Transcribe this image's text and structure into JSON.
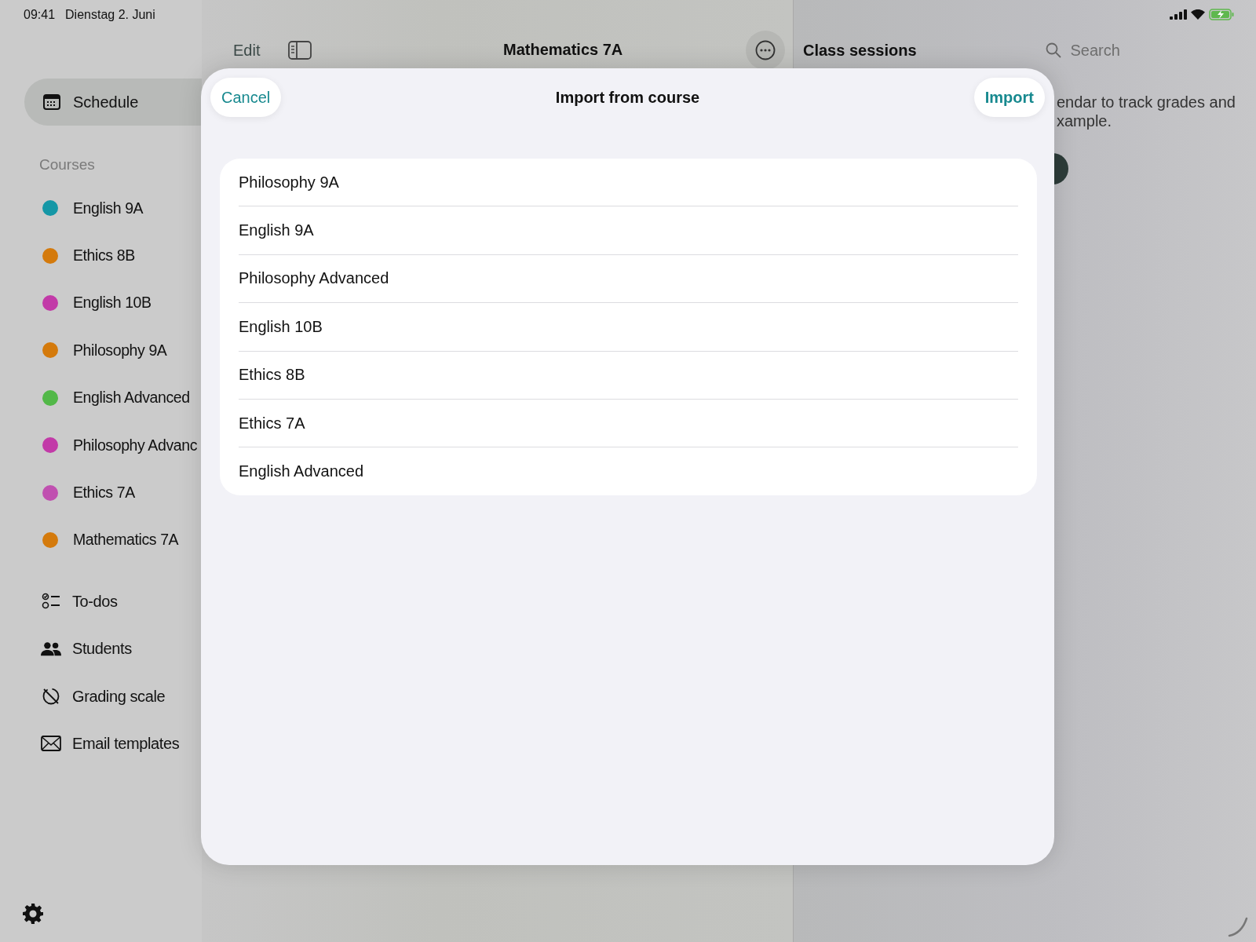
{
  "status_bar": {
    "time": "09:41",
    "date": "Dienstag 2. Juni"
  },
  "sidebar": {
    "items": [
      {
        "label": "Schedule",
        "selected": true
      }
    ],
    "section_title": "Courses",
    "courses": [
      {
        "name": "English 9A",
        "color": "#1597a6"
      },
      {
        "name": "Ethics 8B",
        "color": "#d47a0c"
      },
      {
        "name": "English 10B",
        "color": "#c23aa8"
      },
      {
        "name": "Philosophy 9A",
        "color": "#d47a0c"
      },
      {
        "name": "English Advanced",
        "color": "#52b848"
      },
      {
        "name": "Philosophy Advanc",
        "color": "#c23aa8"
      },
      {
        "name": "Ethics 7A",
        "color": "#c050b0"
      },
      {
        "name": "Mathematics 7A",
        "color": "#d47a0c"
      }
    ],
    "tools": [
      {
        "label": "To-dos",
        "kind": "todo"
      },
      {
        "label": "Students",
        "kind": "people"
      },
      {
        "label": "Grading scale",
        "kind": "scale"
      },
      {
        "label": "Email templates",
        "kind": "mail"
      }
    ]
  },
  "toolbar": {
    "edit": "Edit",
    "title": "Mathematics 7A"
  },
  "detail": {
    "title": "Class sessions",
    "search": {
      "placeholder": "Search"
    },
    "lines": [
      "endar to track grades and",
      "xample."
    ]
  },
  "modal": {
    "title": "Import from course",
    "cancel": "Cancel",
    "confirm": "Import",
    "items": [
      "Philosophy 9A",
      "English 9A",
      "Philosophy Advanced",
      "English 10B",
      "Ethics 8B",
      "Ethics 7A",
      "English Advanced"
    ]
  }
}
